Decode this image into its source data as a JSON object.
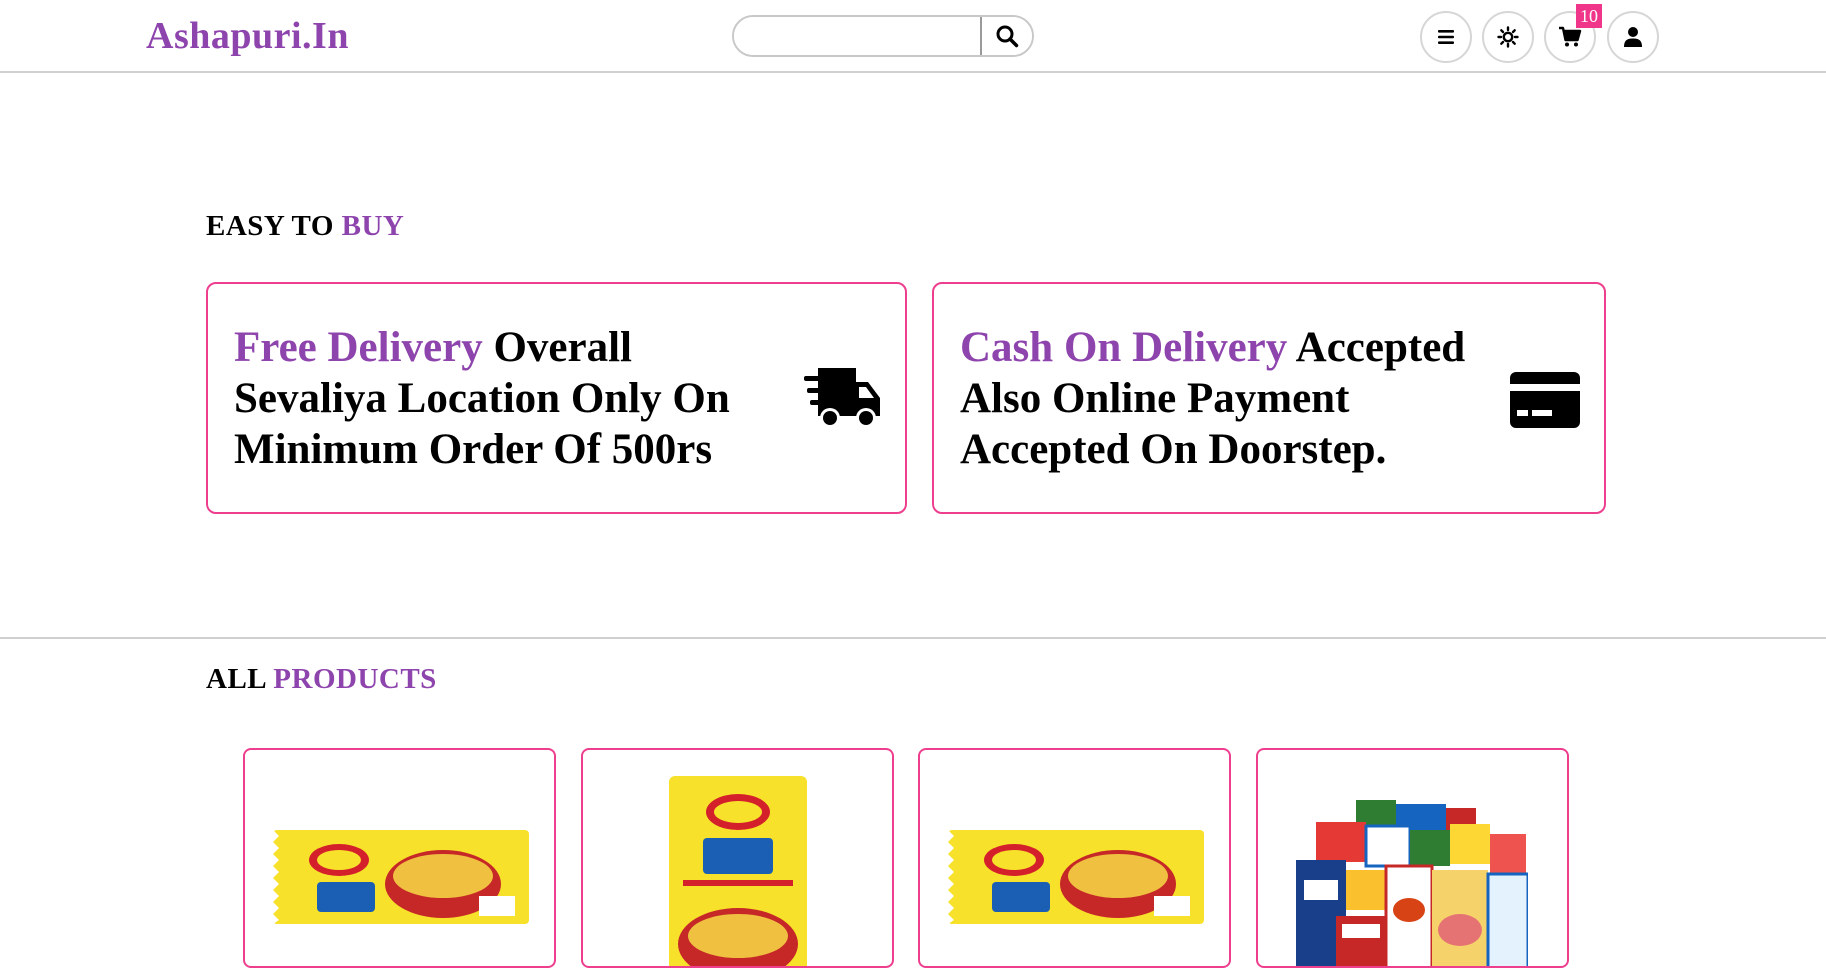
{
  "header": {
    "logo": "Ashapuri.In",
    "search": {
      "value": "",
      "placeholder": ""
    },
    "cart_count": "10",
    "icons": [
      "menu-icon",
      "sun-icon",
      "cart-icon",
      "user-icon"
    ]
  },
  "easy_to_buy": {
    "title_prefix": "EASY TO",
    "title_accent": "BUY",
    "cards": [
      {
        "accent": "Free Delivery",
        "line1_rest": " Overall",
        "line2": "Sevaliya Location Only On",
        "line3": "Minimum Order Of 500rs",
        "icon": "truck-icon"
      },
      {
        "accent": "Cash On Delivery",
        "line1_rest": " Accepted",
        "line2": "Also Online Payment",
        "line3": "Accepted On Doorstep.",
        "icon": "credit-card-icon"
      }
    ]
  },
  "all_products": {
    "title_prefix": "ALL",
    "title_accent": "PRODUCTS",
    "products": [
      {
        "image": "maggi-pack-horizontal"
      },
      {
        "image": "maggi-pack-vertical"
      },
      {
        "image": "maggi-pack-horizontal"
      },
      {
        "image": "grocery-assortment"
      }
    ]
  },
  "colors": {
    "accent": "#8e44ad",
    "border": "#ee3f8f",
    "badge": "#f0368a",
    "maggi_yellow": "#f7e12a",
    "maggi_red": "#d4202a"
  }
}
